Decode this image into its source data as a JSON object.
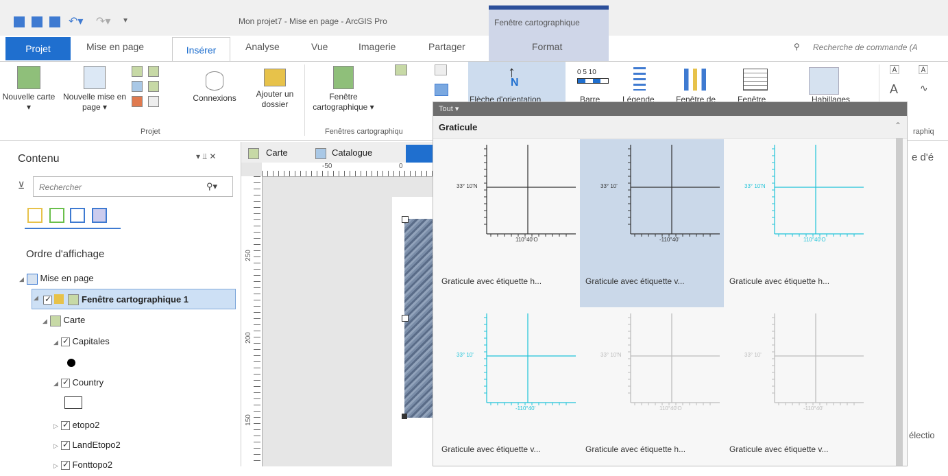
{
  "title_bar": {
    "window_title": "Mon projet7 - Mise en page - ArcGIS Pro",
    "context_tab_header": "Fenêtre cartographique"
  },
  "tabs": [
    "Projet",
    "Mise en page",
    "Insérer",
    "Analyse",
    "Vue",
    "Imagerie",
    "Partager"
  ],
  "context_tab": "Format",
  "search": {
    "placeholder": "Recherche de commande (A"
  },
  "ribbon": {
    "btn_nouvelle_carte": "Nouvelle carte ▾",
    "btn_nouvelle_mise": "Nouvelle mise en page ▾",
    "btn_connexions": "Connexions",
    "btn_ajouter": "Ajouter un dossier",
    "btn_fenetre": "Fenêtre cartographique ▾",
    "btn_fleche": "Flèche d'orientation",
    "btn_barre": "Barre",
    "btn_legende": "Légende",
    "btn_fenetre_de": "Fenêtre de",
    "btn_fenetre2": "Fenêtre",
    "btn_habillages": "Habillages",
    "group_projet": "Projet",
    "group_fenetres": "Fenêtres cartographiqu",
    "group_graphiq": "raphiq",
    "scale_text": "0 5 10"
  },
  "contents": {
    "title": "Contenu",
    "pin": "▾ ⫫ ✕",
    "search_placeholder": "Rechercher",
    "draw_order": "Ordre d'affichage",
    "items": [
      "Mise en page",
      "Fenêtre cartographique 1",
      "Carte",
      "Capitales",
      "Country",
      "etopo2",
      "LandEtopo2",
      "Fonttopo2"
    ]
  },
  "view_tabs": [
    "Carte",
    "Catalogue"
  ],
  "ruler": {
    "top_labels": [
      "-50",
      "0"
    ],
    "left_labels": [
      "250",
      "200",
      "150"
    ]
  },
  "gallery": {
    "filter": "Tout ▾",
    "heading": "Graticule",
    "items": [
      {
        "caption": "Graticule avec étiquette h...",
        "label_a": "33° 10'N",
        "label_b": "110°40'O",
        "color": "#333333"
      },
      {
        "caption": "Graticule avec étiquette v...",
        "label_a": "33° 10'",
        "label_b": "-110°40'",
        "color": "#333333"
      },
      {
        "caption": "Graticule avec étiquette h...",
        "label_a": "33° 10'N",
        "label_b": "110°40'O",
        "color": "#1ec3d8"
      },
      {
        "caption": "Graticule avec étiquette v...",
        "label_a": "33° 10'",
        "label_b": "-110°40'",
        "color": "#1ec3d8"
      },
      {
        "caption": "Graticule avec étiquette h...",
        "label_a": "33° 10'N",
        "label_b": "110°40'O",
        "color": "#bbbbbb"
      },
      {
        "caption": "Graticule avec étiquette v...",
        "label_a": "33° 10'",
        "label_b": "-110°40'",
        "color": "#bbbbbb"
      }
    ]
  },
  "right_strip": {
    "top_text": "e d'é",
    "bottom_text": "électio"
  },
  "colors": {
    "accent": "#1f6fcf",
    "context": "#cfd6e8",
    "selected": "#cad8e9"
  }
}
